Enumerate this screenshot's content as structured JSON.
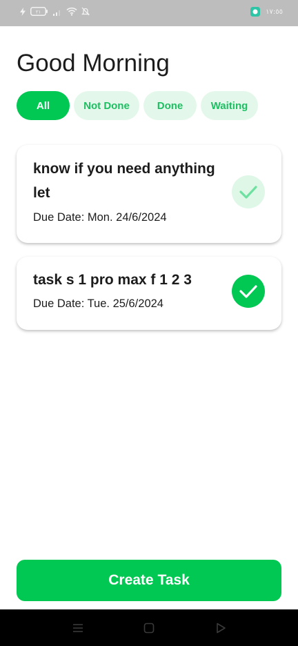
{
  "status_bar": {
    "time": "١٧:٥٥",
    "icons": [
      "charging-icon",
      "battery-icon",
      "signal-icon",
      "wifi-icon",
      "mute-icon",
      "notification-app-icon"
    ],
    "battery_level": "٢١"
  },
  "header": {
    "greeting": "Good Morning"
  },
  "filters": [
    {
      "label": "All",
      "active": true
    },
    {
      "label": "Not Done",
      "active": false
    },
    {
      "label": "Done",
      "active": false
    },
    {
      "label": "Waiting",
      "active": false
    }
  ],
  "tasks": [
    {
      "title": "know if you need anything let",
      "due_date": "Due Date: Mon. 24/6/2024",
      "done": false
    },
    {
      "title": "task s 1 pro max f 1 2 3",
      "due_date": "Due Date: Tue. 25/6/2024",
      "done": true
    }
  ],
  "create_button": {
    "label": "Create Task"
  },
  "nav_bar": {
    "icons": [
      "menu-icon",
      "home-icon",
      "back-icon"
    ]
  },
  "colors": {
    "accent": "#00c853",
    "chip_inactive_bg": "#e3f8ea",
    "chip_inactive_text": "#1dbf62",
    "check_pending_bg": "#def7e7",
    "text": "#1c1c1c"
  }
}
